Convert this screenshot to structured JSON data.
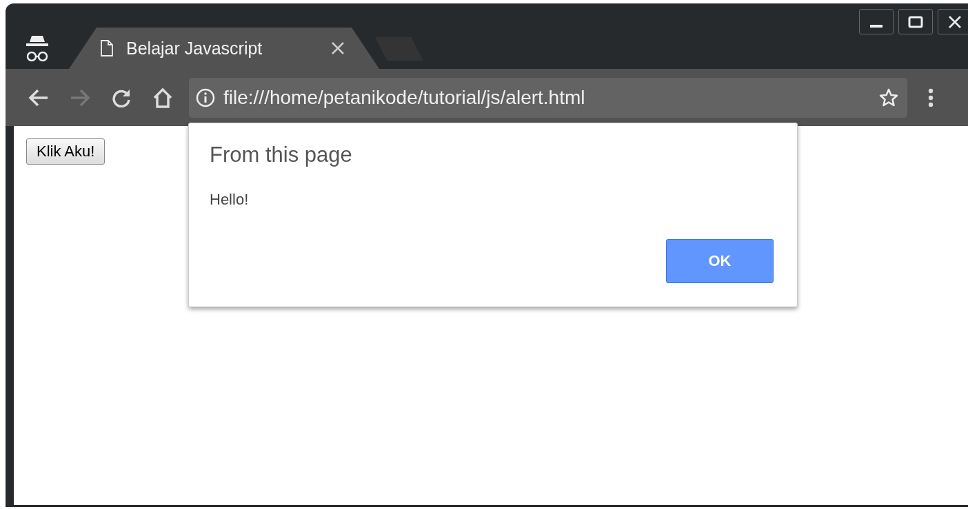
{
  "window": {
    "incognito": true
  },
  "tabs": [
    {
      "title": "Belajar Javascript",
      "selected": true
    }
  ],
  "toolbar": {
    "back_disabled": false,
    "forward_disabled": true
  },
  "address_bar": {
    "url": "file:///home/petanikode/tutorial/js/alert.html"
  },
  "page": {
    "button": "Klik Aku!"
  },
  "dialog": {
    "title": "From this page",
    "message": "Hello!",
    "button": "OK"
  }
}
